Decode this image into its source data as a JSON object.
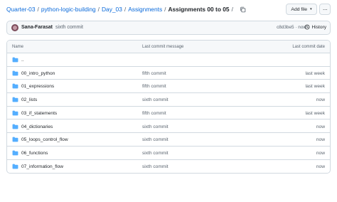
{
  "breadcrumb": {
    "items": [
      "Quarter-03",
      "python-logic-building",
      "Day_03",
      "Assignments"
    ],
    "separator": "/",
    "current": "Assignments 00 to 05",
    "trailing": "/"
  },
  "toolbar": {
    "add_file_label": "Add file",
    "add_file_caret": "▾",
    "more_label": "···"
  },
  "commit": {
    "author": "Sana-Farasat",
    "message": "sixth commit",
    "meta": "c8d3be5 · now",
    "history_label": "History"
  },
  "table": {
    "headers": {
      "name": "Name",
      "message": "Last commit message",
      "date": "Last commit date"
    },
    "rows": [
      {
        "name": "..",
        "message": "",
        "date": ""
      },
      {
        "name": "00_intro_python",
        "message": "fifth commit",
        "date": "last week"
      },
      {
        "name": "01_expressions",
        "message": "fifth commit",
        "date": "last week"
      },
      {
        "name": "02_lists",
        "message": "sixth commit",
        "date": "now"
      },
      {
        "name": "03_if_statements",
        "message": "fifth commit",
        "date": "last week"
      },
      {
        "name": "04_dictionaries",
        "message": "sixth commit",
        "date": "now"
      },
      {
        "name": "05_loops_control_flow",
        "message": "sixth commit",
        "date": "now"
      },
      {
        "name": "06_functions",
        "message": "sixth commit",
        "date": "now"
      },
      {
        "name": "07_information_flow",
        "message": "sixth commit",
        "date": "now"
      }
    ]
  },
  "icons": {
    "folder": "folder-icon",
    "copy": "copy-icon",
    "history": "history-icon",
    "avatar": "avatar"
  },
  "colors": {
    "link": "#0969da",
    "folder": "#54aeff",
    "muted": "#59636e",
    "border": "#d1d9e0"
  }
}
